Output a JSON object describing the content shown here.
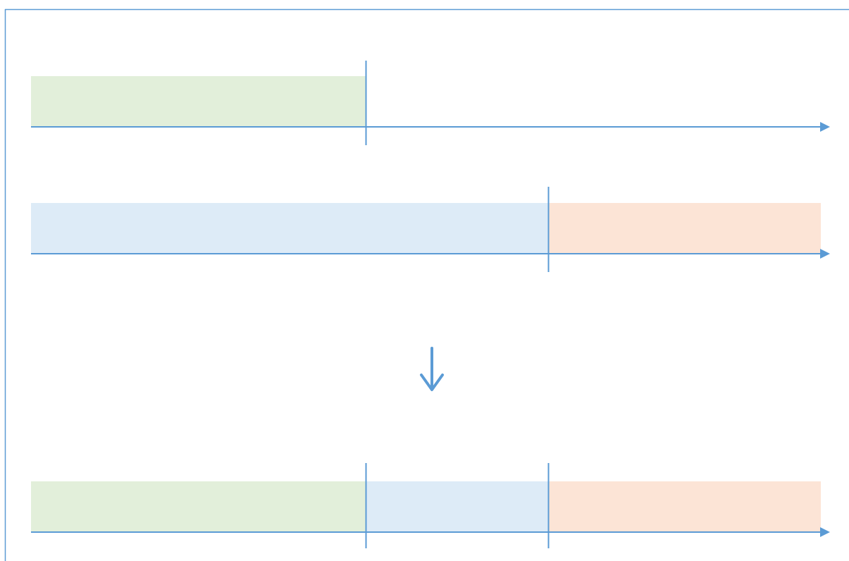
{
  "colors": {
    "line": "#5b9bd5",
    "green": "#e2efda",
    "blue": "#ddebf7",
    "orange": "#fce4d6"
  },
  "timelines": [
    {
      "id": "timeline-1",
      "segments": [
        {
          "fill": "green",
          "from": 0,
          "to": 0.4236
        }
      ],
      "markers": [
        0.4236
      ]
    },
    {
      "id": "timeline-2",
      "segments": [
        {
          "fill": "blue",
          "from": 0,
          "to": 0.6548
        },
        {
          "fill": "orange",
          "from": 0.6548,
          "to": 1.0
        }
      ],
      "markers": [
        0.6548
      ]
    },
    {
      "id": "timeline-result",
      "segments": [
        {
          "fill": "green",
          "from": 0,
          "to": 0.4236
        },
        {
          "fill": "blue",
          "from": 0.4236,
          "to": 0.6548
        },
        {
          "fill": "orange",
          "from": 0.6548,
          "to": 1.0
        }
      ],
      "markers": [
        0.4236,
        0.6548
      ]
    }
  ],
  "transition_arrow": {
    "icon": "arrow-down-icon",
    "direction": "down"
  }
}
